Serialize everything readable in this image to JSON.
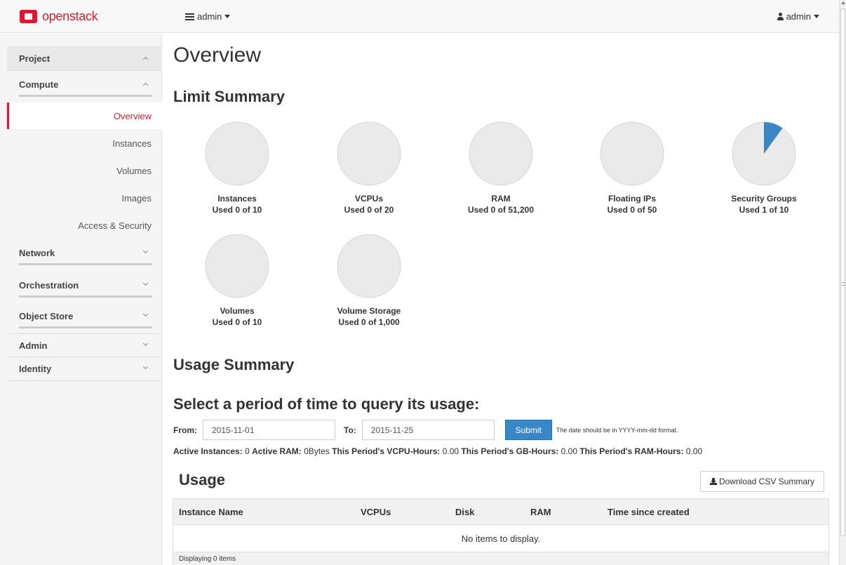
{
  "navbar": {
    "brand": "openstack",
    "project_menu": "admin",
    "user_menu": "admin"
  },
  "sidebar": {
    "sections": {
      "project": "Project",
      "compute": "Compute",
      "network": "Network",
      "orchestration": "Orchestration",
      "object_store": "Object Store",
      "admin": "Admin",
      "identity": "Identity"
    },
    "compute_items": [
      "Overview",
      "Instances",
      "Volumes",
      "Images",
      "Access & Security"
    ],
    "active_item": "Overview",
    "accent_color": "#da1a32"
  },
  "main": {
    "title": "Overview",
    "limit_summary": "Limit Summary",
    "limits": [
      {
        "name": "Instances",
        "text": "Used 0 of 10",
        "used": 0,
        "total": 10
      },
      {
        "name": "VCPUs",
        "text": "Used 0 of 20",
        "used": 0,
        "total": 20
      },
      {
        "name": "RAM",
        "text": "Used 0 of 51,200",
        "used": 0,
        "total": 51200
      },
      {
        "name": "Floating IPs",
        "text": "Used 0 of 50",
        "used": 0,
        "total": 50
      },
      {
        "name": "Security Groups",
        "text": "Used 1 of 10",
        "used": 1,
        "total": 10
      },
      {
        "name": "Volumes",
        "text": "Used 0 of 10",
        "used": 0,
        "total": 10
      },
      {
        "name": "Volume Storage",
        "text": "Used 0 of 1,000",
        "used": 0,
        "total": 1000
      }
    ],
    "pie_colors": {
      "empty": "#eaeaea",
      "used": "#3a87c8",
      "border": "#d6d6d6"
    },
    "usage_summary": "Usage Summary",
    "query_heading": "Select a period of time to query its usage:",
    "form": {
      "from_label": "From:",
      "from_value": "2015-11-01",
      "to_label": "To:",
      "to_value": "2015-11-25",
      "submit": "Submit",
      "help": "The date should be in YYYY-mm-dd format."
    },
    "stats": {
      "active_instances_label": "Active Instances:",
      "active_instances": "0",
      "active_ram_label": "Active RAM:",
      "active_ram": "0Bytes",
      "vcpu_hours_label": "This Period's VCPU-Hours:",
      "vcpu_hours": "0.00",
      "gb_hours_label": "This Period's GB-Hours:",
      "gb_hours": "0.00",
      "ram_hours_label": "This Period's RAM-Hours:",
      "ram_hours": "0.00"
    },
    "usage_heading": "Usage",
    "download_csv": "Download CSV Summary",
    "table": {
      "columns": [
        "Instance Name",
        "VCPUs",
        "Disk",
        "RAM",
        "Time since created"
      ],
      "empty": "No items to display.",
      "footer": "Displaying 0 items"
    }
  }
}
